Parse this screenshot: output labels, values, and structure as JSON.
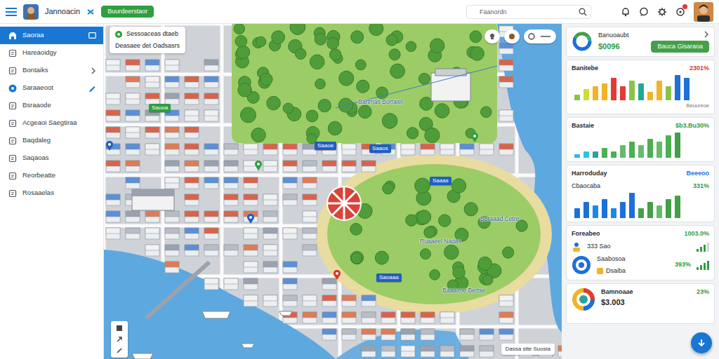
{
  "topbar": {
    "app_name": "Jannoacin",
    "action_button": "Buurdeerstaor",
    "search": {
      "placeholder": "Faanordn"
    }
  },
  "sidebar": {
    "items": [
      {
        "label": "Saoraa",
        "selected": true
      },
      {
        "label": "Hareaoidgy",
        "selected": false
      },
      {
        "label": "Bontaiks",
        "selected": false
      },
      {
        "label": "Saraaeoot",
        "selected": false
      },
      {
        "label": "Bsraaode",
        "selected": false
      },
      {
        "label": "Acgeaoi Saegtiraa",
        "selected": false
      },
      {
        "label": "Baqdaleg",
        "selected": false
      },
      {
        "label": "Saqaoas",
        "selected": false
      },
      {
        "label": "Reorbeatte",
        "selected": false
      },
      {
        "label": "Rosaaelas",
        "selected": false
      }
    ]
  },
  "map": {
    "info_card": {
      "title": "Sessoaceas dtaeb",
      "subtitle": "Deasaee det Oadsasrs"
    },
    "area_labels": [
      "Bartmas Borraiel",
      "Beraaad Cetre",
      "Ruaaeel Nadas",
      "Baaaeoe Bertse"
    ],
    "pins": [
      {
        "label": "Saaoe",
        "color": "#1f5fbf"
      },
      {
        "label": "Saaos",
        "color": "#1f5fbf"
      },
      {
        "label": "Saaas",
        "color": "#1f5fbf"
      },
      {
        "label": "Saoaaa",
        "color": "#1f5fbf"
      },
      {
        "label": "Sauoa",
        "color": "#2e9e3f"
      }
    ],
    "status_strip": "Dassa stte Suosia"
  },
  "panel": {
    "summary": {
      "title": "Banuoaubt",
      "value": "$0096",
      "button": "Bauca Gisaraoa"
    },
    "charts": [
      {
        "title": "Banitebe",
        "value": "2301%",
        "value_color": "#d9342b",
        "caption": "Beuureoe",
        "bars": [
          {
            "value": 2,
            "color": "#8bc34a"
          },
          {
            "value": 4,
            "color": "#cddc39"
          },
          {
            "value": 5,
            "color": "#f0b429"
          },
          {
            "value": 6,
            "color": "#f0b429"
          },
          {
            "value": 8,
            "color": "#e53935"
          },
          {
            "value": 5,
            "color": "#e53935"
          },
          {
            "value": 7,
            "color": "#8bc34a"
          },
          {
            "value": 6,
            "color": "#26a69a"
          },
          {
            "value": 3,
            "color": "#f0b429"
          },
          {
            "value": 7,
            "color": "#f0b429"
          },
          {
            "value": 5,
            "color": "#8bc34a"
          },
          {
            "value": 9,
            "color": "#1e6fd9"
          },
          {
            "value": 8,
            "color": "#1e6fd9"
          }
        ]
      },
      {
        "title": "Bastaie",
        "value": "$b3.Bu30%",
        "value_color": "#2e9e3f",
        "bars": [
          {
            "value": 1,
            "color": "#29b6f6"
          },
          {
            "value": 2,
            "color": "#26c6da"
          },
          {
            "value": 2,
            "color": "#26a69a"
          },
          {
            "value": 3,
            "color": "#4caf50"
          },
          {
            "value": 2,
            "color": "#4caf50"
          },
          {
            "value": 4,
            "color": "#66bb6a"
          },
          {
            "value": 5,
            "color": "#4caf50"
          },
          {
            "value": 4,
            "color": "#66bb6a"
          },
          {
            "value": 6,
            "color": "#4caf50"
          },
          {
            "value": 5,
            "color": "#66bb6a"
          },
          {
            "value": 7,
            "color": "#4caf50"
          },
          {
            "value": 8,
            "color": "#43a047"
          }
        ]
      },
      {
        "title": "Harroduday",
        "value": "Beeeoo",
        "value_color": "#1a73e8",
        "subtitle": "Cbaocaba",
        "subvalue": "331%",
        "bars": [
          {
            "value": 3,
            "color": "#1e6fd9"
          },
          {
            "value": 5,
            "color": "#1e6fd9"
          },
          {
            "value": 4,
            "color": "#1e88e5"
          },
          {
            "value": 6,
            "color": "#1e6fd9"
          },
          {
            "value": 3,
            "color": "#1e88e5"
          },
          {
            "value": 5,
            "color": "#1e6fd9"
          },
          {
            "value": 8,
            "color": "#1e6fd9"
          },
          {
            "value": 3,
            "color": "#43a047"
          },
          {
            "value": 5,
            "color": "#43a047"
          },
          {
            "value": 4,
            "color": "#66bb6a"
          },
          {
            "value": 6,
            "color": "#43a047"
          },
          {
            "value": 7,
            "color": "#43a047"
          }
        ]
      }
    ],
    "list_card": {
      "title": "Foreabeo",
      "value": "1003.0%",
      "rows": [
        {
          "label": "333 Sao",
          "level": 0.75
        },
        {
          "label": "Saabosoa",
          "value": "393%",
          "note": "Dsaiba",
          "level": 1
        }
      ]
    },
    "footer_card": {
      "title": "Bamnoaae",
      "value": "$3.003",
      "percent": "23%"
    }
  }
}
